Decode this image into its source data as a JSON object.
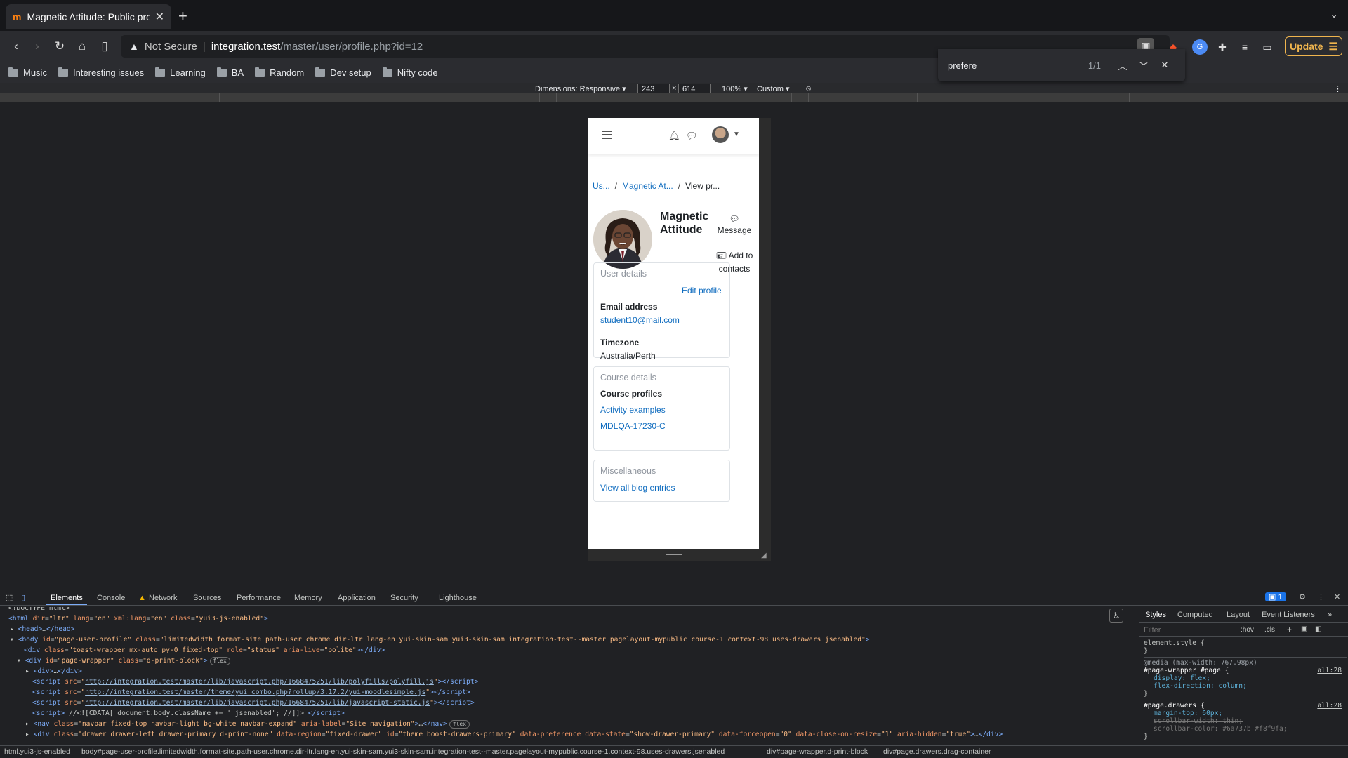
{
  "browser": {
    "tab_title": "Magnetic Attitude: Public profile",
    "tab_favicon": "moodle-logo-icon",
    "new_tab": "+",
    "url_warning": "Not Secure",
    "url_host": "integration.test",
    "url_path": "/master/user/profile.php?id=12",
    "update_label": "Update"
  },
  "bookmarks": [
    "Music",
    "Interesting issues",
    "Learning",
    "BA",
    "Random",
    "Dev setup",
    "Nifty code"
  ],
  "find": {
    "query": "prefere",
    "count": "1/1"
  },
  "device": {
    "dimensions_label": "Dimensions: Responsive",
    "width": "243",
    "times": "×",
    "height": "614",
    "zoom": "100%",
    "throttle": "Custom"
  },
  "moodle": {
    "crumbs": [
      "Us...",
      "Magnetic At...",
      "View pr..."
    ],
    "user_name": "Magnetic Attitude",
    "message_label": "Message",
    "add_contacts_label": "Add to contacts",
    "user_details": {
      "title": "User details",
      "edit": "Edit profile",
      "email_label": "Email address",
      "email": "student10@mail.com",
      "timezone_label": "Timezone",
      "timezone": "Australia/Perth"
    },
    "course_details": {
      "title": "Course details",
      "profiles_label": "Course profiles",
      "courses": [
        "Activity examples",
        "MDLQA-17230-C"
      ]
    },
    "misc": {
      "title": "Miscellaneous",
      "blog": "View all blog entries"
    }
  },
  "devtools": {
    "tabs": [
      "Elements",
      "Console",
      "Network",
      "Sources",
      "Performance",
      "Memory",
      "Application",
      "Security",
      "Lighthouse"
    ],
    "issues_count": "1",
    "styles_tabs": [
      "Styles",
      "Computed",
      "Layout",
      "Event Listeners"
    ],
    "filter_placeholder": "Filter",
    "hov": ":hov",
    "cls": ".cls",
    "styles_lines": [
      "element.style {",
      "}",
      "@media (max-width: 767.98px)",
      "#page-wrapper #page {",
      "display: flex;",
      "flex-direction: column;",
      "}",
      "#page.drawers {",
      "margin-top: 60px;",
      "scrollbar-width: thin;",
      "scrollbar-color: #6a737b #f8f9fa;",
      "}"
    ],
    "source_ref": "all:28",
    "breadcrumbs": [
      "html.yui3-js-enabled",
      "body#page-user-profile.limitedwidth.format-site.path-user.chrome.dir-ltr.lang-en.yui-skin-sam.yui3-skin-sam.integration-test--master.pagelayout-mypublic.course-1.context-98.uses-drawers.jsenabled",
      "div#page-wrapper.d-print-block",
      "div#page.drawers.drag-container"
    ]
  }
}
